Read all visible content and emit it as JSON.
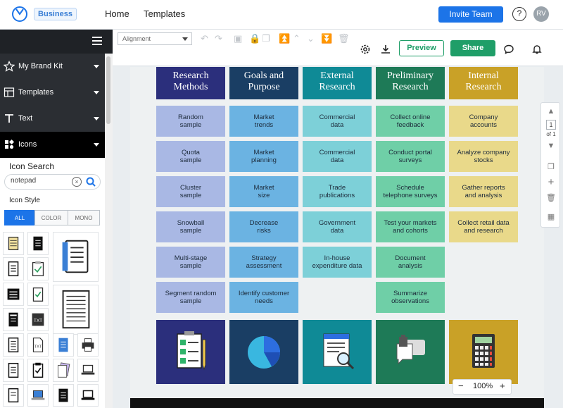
{
  "topnav": {
    "badge": "Business",
    "links": [
      "Home",
      "Templates"
    ],
    "invite": "Invite Team",
    "help": "?",
    "avatar": "RV"
  },
  "sidebar": {
    "items": [
      {
        "label": "My Brand Kit",
        "icon": "star-icon"
      },
      {
        "label": "Templates",
        "icon": "templates-icon"
      },
      {
        "label": "Text",
        "icon": "text-icon"
      },
      {
        "label": "Icons",
        "icon": "icons-icon"
      }
    ],
    "icon_search": {
      "title": "Icon Search",
      "value": "notepad",
      "style_title": "Icon Style",
      "styles": [
        "ALL",
        "COLOR",
        "MONO"
      ],
      "active_style": "ALL"
    }
  },
  "toolbar": {
    "align_label": "Alignment",
    "preview": "Preview",
    "share": "Share"
  },
  "canvas": {
    "columns": [
      {
        "title": "Research\nMethods",
        "head_color": "#2b2f7c",
        "cell_color": "#a9b8e4",
        "items": [
          "Random\nsample",
          "Quota\nsample",
          "Cluster\nsample",
          "Snowball\nsample",
          "Multi-stage\nsample",
          "Segment random\nsample"
        ]
      },
      {
        "title": "Goals and\nPurpose",
        "head_color": "#1a3e64",
        "cell_color": "#6bb3e2",
        "items": [
          "Market\ntrends",
          "Market\nplanning",
          "Market\nsize",
          "Decrease\nrisks",
          "Strategy\nassessment",
          "Identify customer\nneeds"
        ]
      },
      {
        "title": "External\nResearch",
        "head_color": "#0f8a96",
        "cell_color": "#7dd0d8",
        "items": [
          "Commercial\ndata",
          "Commercial\ndata",
          "Trade\npublications",
          "Government\ndata",
          "In-house\nexpenditure data"
        ]
      },
      {
        "title": "Preliminary\nResearch",
        "head_color": "#1e7a57",
        "cell_color": "#6fcfa7",
        "items": [
          "Collect online\nfeedback",
          "Conduct portal\nsurveys",
          "Schedule\ntelephone surveys",
          "Test your markets\nand cohorts",
          "Document\nanalysis",
          "Summarize\nobservations"
        ]
      },
      {
        "title": "Internal\nResearch",
        "head_color": "#c9a127",
        "cell_color": "#e9d98a",
        "items": [
          "Company\naccounts",
          "Analyze company\nstocks",
          "Gather reports\nand analysis",
          "Collect retail data\nand research"
        ]
      }
    ]
  },
  "pager": {
    "current": "1",
    "of": "of 1"
  },
  "zoom": {
    "minus": "−",
    "value": "100%",
    "plus": "+"
  }
}
